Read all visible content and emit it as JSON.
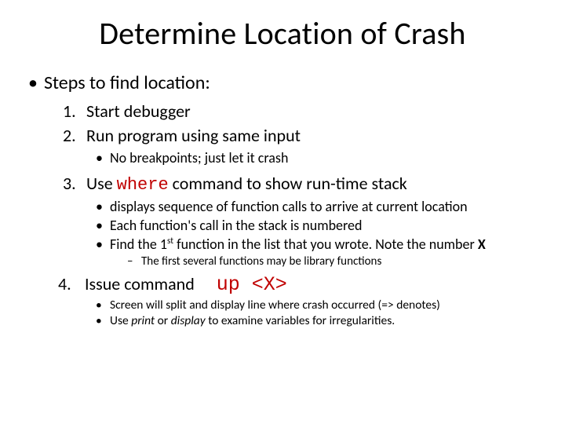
{
  "title": "Determine Location of Crash",
  "intro": "Steps to find location:",
  "steps": {
    "s1": {
      "num": "1.",
      "text": "Start debugger"
    },
    "s2": {
      "num": "2.",
      "text": "Run program using same input",
      "sub": {
        "a": "No breakpoints; just let it crash"
      }
    },
    "s3": {
      "num": "3.",
      "pre": "Use ",
      "cmd": "where",
      "post": " command to show run-time stack",
      "sub": {
        "a": "displays sequence of function calls to arrive at current location",
        "b": "Each function's call in the stack is numbered",
        "c_pre": "Find the 1",
        "c_sup": "st",
        "c_post": " function in the list that you wrote. Note the number ",
        "c_bold": "X"
      },
      "note": "The first several functions may be library functions"
    },
    "s4": {
      "num": "4.",
      "text": "Issue command",
      "cmd": "up <X>",
      "sub": {
        "a": "Screen will split and display line where crash occurred (=> denotes)",
        "b_pre": "Use ",
        "b_i1": "print",
        "b_mid": " or ",
        "b_i2": "display",
        "b_post": " to examine variables for irregularities."
      }
    }
  },
  "glyph": {
    "bullet": "•",
    "dash": "–"
  }
}
